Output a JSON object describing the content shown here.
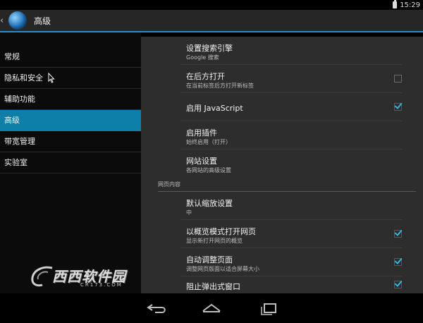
{
  "status": {
    "time": "15:29"
  },
  "actionbar": {
    "title": "高级"
  },
  "sidebar": {
    "items": [
      {
        "label": "常规"
      },
      {
        "label": "隐私和安全"
      },
      {
        "label": "辅助功能"
      },
      {
        "label": "高级"
      },
      {
        "label": "带宽管理"
      },
      {
        "label": "实验室"
      }
    ],
    "active_index": 3
  },
  "settings": {
    "search_engine": {
      "title": "设置搜索引擎",
      "summary": "Google 搜索"
    },
    "open_background": {
      "title": "在后方打开",
      "summary": "在当前标签后方打开新标签",
      "checked": false
    },
    "javascript": {
      "title": "启用 JavaScript",
      "checked": true
    },
    "plugins": {
      "title": "启用插件",
      "summary": "始终启用（打开）"
    },
    "website": {
      "title": "网站设置",
      "summary": "各网站的高级设置"
    },
    "section_label": "网页内容",
    "zoom": {
      "title": "默认缩放设置",
      "summary": "中"
    },
    "overview": {
      "title": "以概览模式打开网页",
      "summary": "显示新打开网页的概览",
      "checked": true
    },
    "autofit": {
      "title": "自动调整页面",
      "summary": "调整网页版面以适合屏幕大小",
      "checked": true
    },
    "popups": {
      "title": "阻止弹出式窗口",
      "checked": true
    }
  },
  "watermark": {
    "text": "西西软件园",
    "sub": "CR173.COM"
  },
  "colors": {
    "accent": "#1f8fd1",
    "active_item": "#0e7fa9",
    "check": "#33b5e5"
  }
}
